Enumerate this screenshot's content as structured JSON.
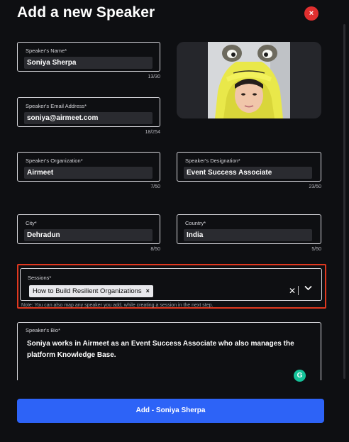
{
  "modal": {
    "title": "Add a new Speaker",
    "close_icon": "close-icon",
    "close_glyph": "×"
  },
  "fields": {
    "name": {
      "label": "Speaker's Name*",
      "value": "Soniya Sherpa",
      "counter": "13/30"
    },
    "email": {
      "label": "Speaker's Email Address*",
      "value": "soniya@airmeet.com",
      "counter": "18/254"
    },
    "organization": {
      "label": "Speaker's Organization*",
      "value": "Airmeet",
      "counter": "7/50"
    },
    "designation": {
      "label": "Speaker's Designation*",
      "value": "Event Success Associate",
      "counter": "23/50"
    },
    "city": {
      "label": "City*",
      "value": "Dehradun",
      "counter": "8/50"
    },
    "country": {
      "label": "Country*",
      "value": "India",
      "counter": "5/50"
    }
  },
  "sessions": {
    "label": "Sessions*",
    "chips": [
      "How to Build Resilient Organizations"
    ],
    "chip_remove_glyph": "×",
    "clear_glyph": "✕",
    "dropdown_glyph": "⌄",
    "note": "Note: You can also map any speaker you add, while creating a session in the next step."
  },
  "bio": {
    "label": "Speaker's Bio*",
    "value": "Soniya works in Airmeet as an Event Success Associate who also manages the platform Knowledge Base.",
    "grammarly_glyph": "G"
  },
  "submit": {
    "label": "Add - Soniya Sherpa"
  },
  "colors": {
    "background": "#0e0f12",
    "accent": "#2d63f7",
    "close": "#e02f2f",
    "highlight_border": "#e0381f",
    "grammarly": "#15c39a"
  }
}
